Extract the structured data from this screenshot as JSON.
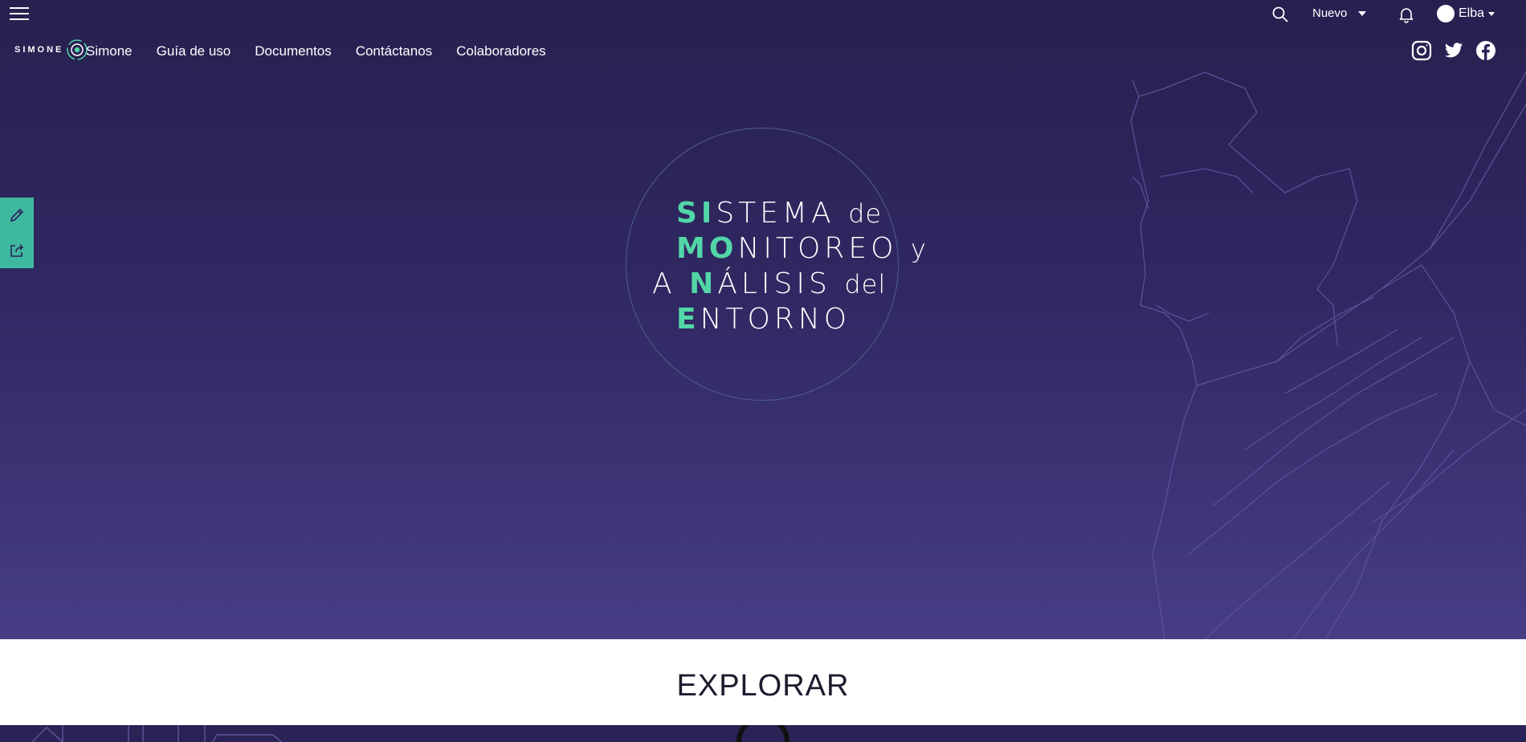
{
  "adminbar": {
    "menu_icon": "hamburger-icon",
    "search_icon": "search-icon",
    "new_label": "Nuevo",
    "notifications_icon": "bell-icon",
    "user_name": "Elba"
  },
  "nav": {
    "logo_text": "SIMONE",
    "links": [
      "Simone",
      "Guía de uso",
      "Documentos",
      "Contáctanos",
      "Colaboradores"
    ],
    "social_icons": [
      "instagram-icon",
      "twitter-icon",
      "facebook-icon"
    ]
  },
  "sidetools": [
    "pencil-icon",
    "share-icon"
  ],
  "hero": {
    "line1_hl": "SI",
    "line1_rest": "STEMA",
    "line1_small": "de",
    "line2_hl": "MO",
    "line2_rest": "NITOREO",
    "line2_small": "y",
    "line3_pre": "A",
    "line3_hl": "N",
    "line3_rest": "ÁLISIS",
    "line3_small": "del",
    "line4_hl": "E",
    "line4_rest": "NTORNO"
  },
  "explore": {
    "title": "EXPLORAR"
  },
  "colors": {
    "accent": "#52d6a7",
    "hero_top": "#27204f",
    "hero_bottom": "#463d85",
    "tool_bg": "#3fb8a0"
  }
}
